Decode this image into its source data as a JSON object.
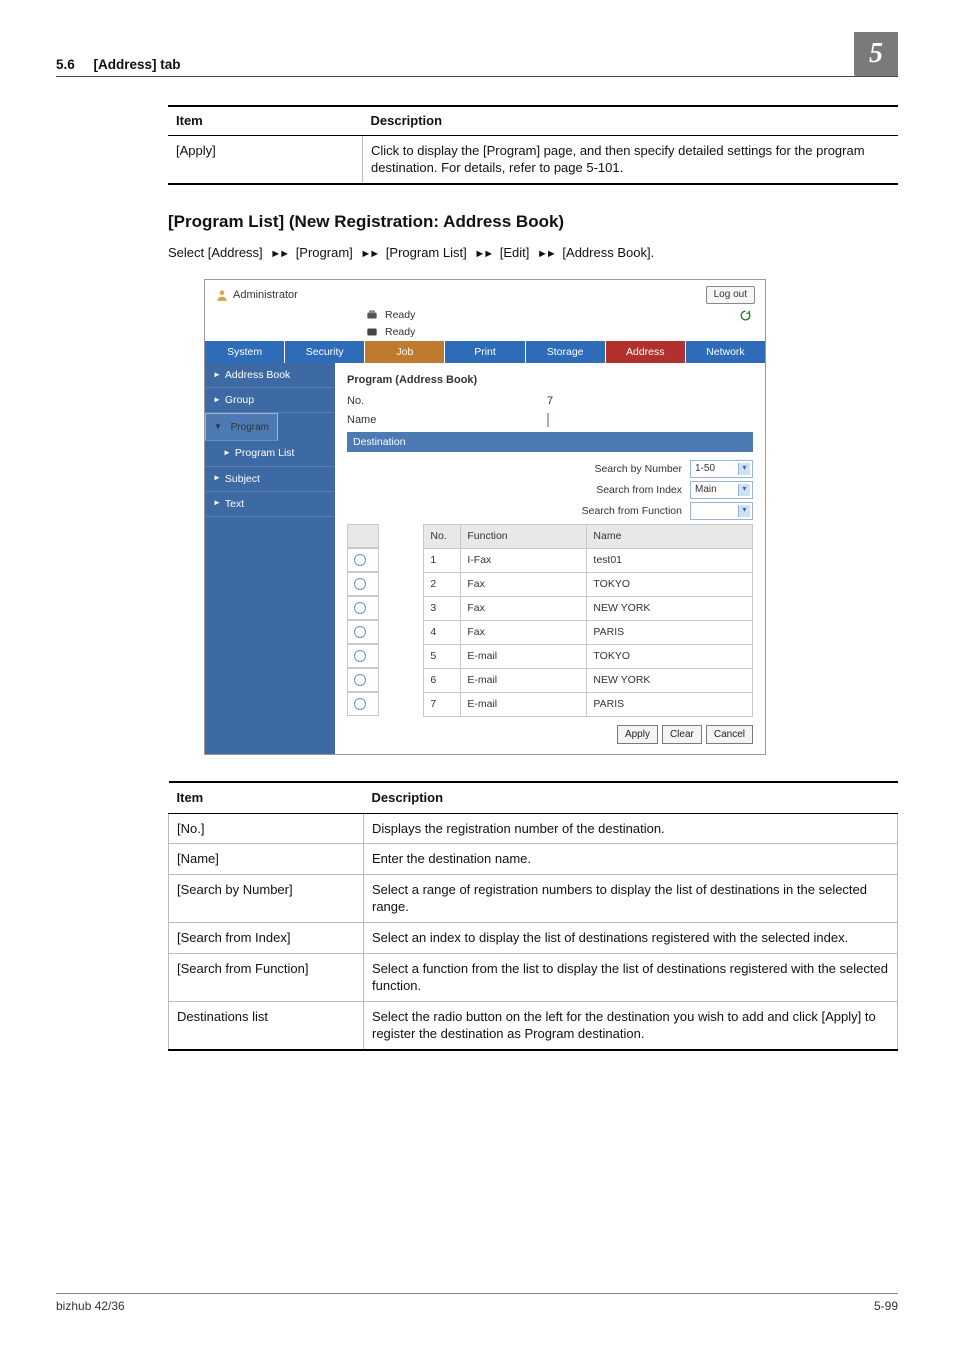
{
  "page": {
    "section_number": "5.6",
    "section_title": "[Address] tab",
    "chapter": "5",
    "footer_left": "bizhub 42/36",
    "footer_right": "5-99"
  },
  "tinytop": {
    "headers": {
      "item": "Item",
      "desc": "Description"
    },
    "rows": [
      {
        "item": "[Apply]",
        "desc": "Click to display the [Program] page, and then specify detailed settings for the program destination. For details, refer to page 5-101."
      }
    ]
  },
  "heading": "[Program List] (New Registration: Address Book)",
  "lead": {
    "prefix": "Select [Address]",
    "arrow": "►►",
    "parts": [
      "[Program]",
      "[Program List]",
      "[Edit]",
      "[Address Book]."
    ]
  },
  "shot": {
    "admin_label": "Administrator",
    "logout": "Log out",
    "ready1": "Ready",
    "ready2": "Ready",
    "tabs": [
      "System",
      "Security",
      "Job",
      "Print",
      "Storage",
      "Address",
      "Network"
    ],
    "sidemenu": [
      {
        "label": "Address Book",
        "pre": "►",
        "child": false
      },
      {
        "label": "Group",
        "pre": "►",
        "child": false
      },
      {
        "label": "Program",
        "pre": "▼",
        "child": false,
        "sel": true
      },
      {
        "label": "Program List",
        "pre": "►",
        "child": true
      },
      {
        "label": "Subject",
        "pre": "►",
        "child": false
      },
      {
        "label": "Text",
        "pre": "►",
        "child": false
      }
    ],
    "panel_title": "Program (Address Book)",
    "fields": {
      "no_label": "No.",
      "no_value": "7",
      "name_label": "Name",
      "name_value": ""
    },
    "dest_header": "Destination",
    "searches": [
      {
        "label": "Search by Number",
        "value": "1-50"
      },
      {
        "label": "Search from Index",
        "value": "Main"
      },
      {
        "label": "Search from Function",
        "value": ""
      }
    ],
    "table": {
      "headers": {
        "no": "No.",
        "func": "Function",
        "name": "Name"
      },
      "rows": [
        {
          "no": "1",
          "func": "I-Fax",
          "name": "test01"
        },
        {
          "no": "2",
          "func": "Fax",
          "name": "TOKYO"
        },
        {
          "no": "3",
          "func": "Fax",
          "name": "NEW YORK"
        },
        {
          "no": "4",
          "func": "Fax",
          "name": "PARIS"
        },
        {
          "no": "5",
          "func": "E-mail",
          "name": "TOKYO"
        },
        {
          "no": "6",
          "func": "E-mail",
          "name": "NEW YORK"
        },
        {
          "no": "7",
          "func": "E-mail",
          "name": "PARIS"
        }
      ]
    },
    "buttons": {
      "apply": "Apply",
      "clear": "Clear",
      "cancel": "Cancel"
    }
  },
  "desctable": {
    "headers": {
      "item": "Item",
      "desc": "Description"
    },
    "rows": [
      {
        "item": "[No.]",
        "desc": "Displays the registration number of the destination."
      },
      {
        "item": "[Name]",
        "desc": "Enter the destination name."
      },
      {
        "item": "[Search by Number]",
        "desc": "Select a range of registration numbers to display the list of destinations in the selected range."
      },
      {
        "item": "[Search from Index]",
        "desc": "Select an index to display the list of destinations registered with the selected index."
      },
      {
        "item": "[Search from Function]",
        "desc": "Select a function from the list to display the list of destinations registered with the selected function."
      },
      {
        "item": "Destinations list",
        "desc": "Select the radio button on the left for the destination you wish to add and click [Apply] to register the destination as Program destination."
      }
    ]
  }
}
